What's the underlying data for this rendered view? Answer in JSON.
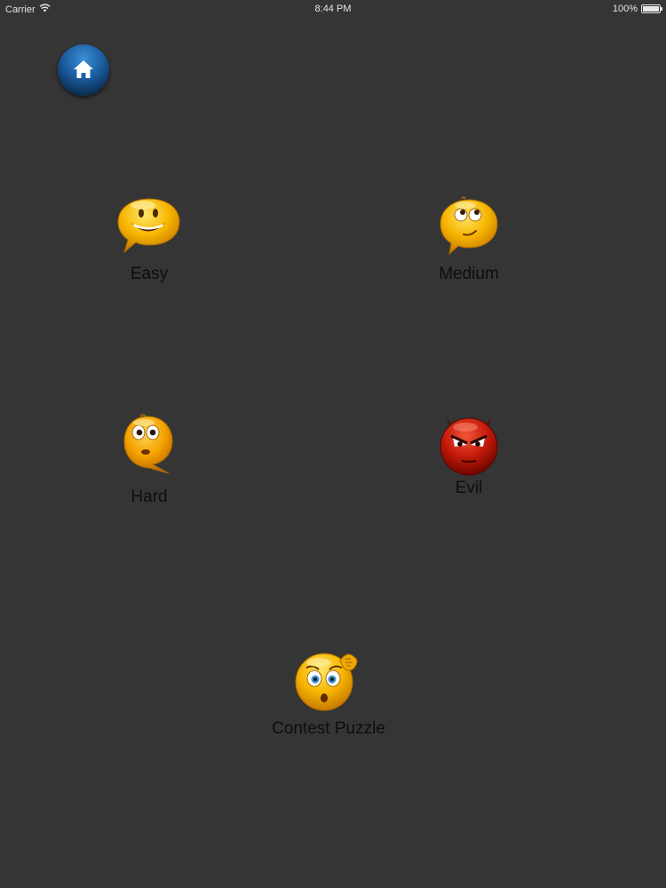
{
  "status_bar": {
    "carrier": "Carrier",
    "time": "8:44 PM",
    "battery": "100%",
    "battery_level": 1.0
  },
  "home_button": {
    "icon": "home-icon",
    "color": "#1b5a9d"
  },
  "levels": {
    "easy": {
      "label": "Easy",
      "icon": "smiling-face-icon"
    },
    "medium": {
      "label": "Medium",
      "icon": "thinking-face-icon"
    },
    "hard": {
      "label": "Hard",
      "icon": "surprised-face-icon"
    },
    "evil": {
      "label": "Evil",
      "icon": "devil-face-icon"
    },
    "contest": {
      "label": "Contest Puzzle",
      "icon": "confused-face-icon"
    }
  },
  "colors": {
    "background": "#353535",
    "label_text": "#0d0d0d",
    "emoji_yellow": "#f7b500",
    "evil_red": "#c41a0a"
  }
}
